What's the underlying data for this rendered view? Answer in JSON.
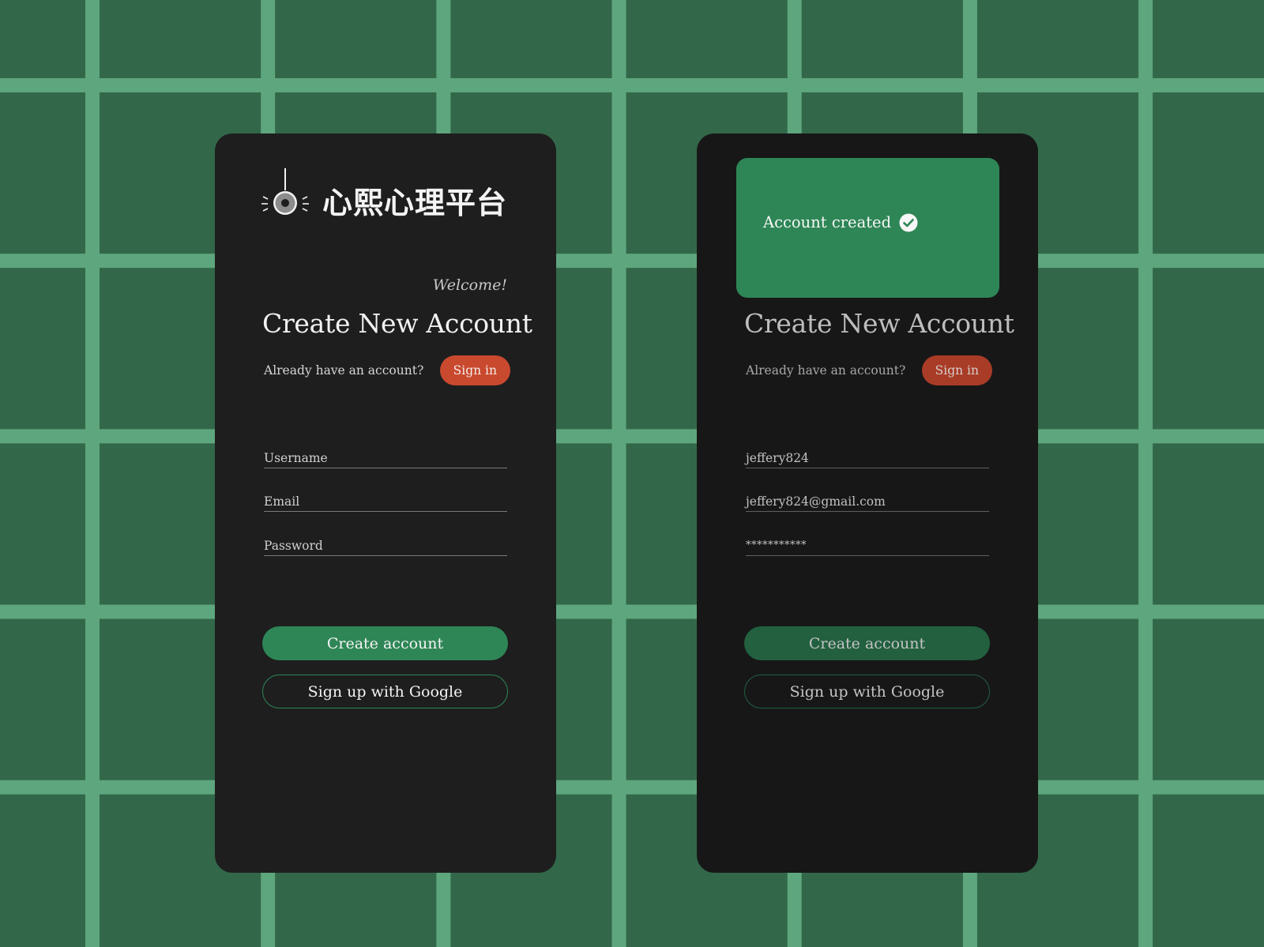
{
  "colors": {
    "background": "#326849",
    "grid_lines": "#5ea67d",
    "card": "#1e1e1f",
    "accent_green": "#2e8656",
    "signin_red": "#c9492e",
    "text_light": "#f2f2f2"
  },
  "left_screen": {
    "brand": {
      "logo_icon": "lamp-icon",
      "name": "心熙心理平台"
    },
    "welcome": "Welcome!",
    "title": "Create New Account",
    "signin_prompt": "Already have an account?",
    "signin_label": "Sign in",
    "fields": {
      "username_placeholder": "Username",
      "email_placeholder": "Email",
      "password_placeholder": "Password"
    },
    "create_label": "Create account",
    "google_label": "Sign up with Google"
  },
  "right_screen": {
    "banner": {
      "text": "Account created",
      "icon": "check-circle-icon"
    },
    "title": "Create New Account",
    "signin_prompt": "Already have an account?",
    "signin_label": "Sign in",
    "fields": {
      "username_value": "jeffery824",
      "email_value": "jeffery824@gmail.com",
      "password_value": "***********"
    },
    "create_label": "Create account",
    "google_label": "Sign up with Google"
  }
}
